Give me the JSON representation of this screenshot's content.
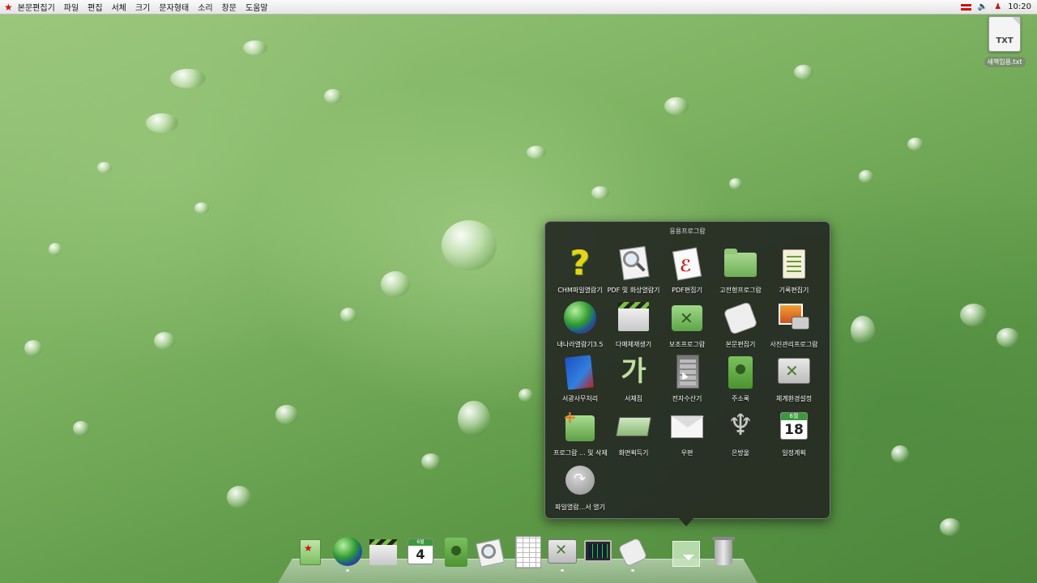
{
  "menubar": {
    "app_name": "본문편집기",
    "items": [
      "파일",
      "편집",
      "서체",
      "크기",
      "문자형태",
      "소리",
      "창문",
      "도움말"
    ],
    "clock": "10:20"
  },
  "desktop": {
    "file": {
      "ext": "TXT",
      "name": "새책임용.txt"
    }
  },
  "stack": {
    "title": "응용프로그람",
    "apps": [
      {
        "label": "CHM파일열람기",
        "icon": "chm-help-icon"
      },
      {
        "label": "PDF 및 화상열람기",
        "icon": "pdf-viewer-icon"
      },
      {
        "label": "PDF편집기",
        "icon": "pdf-editor-icon"
      },
      {
        "label": "고전형프로그람",
        "icon": "folder-icon"
      },
      {
        "label": "기록편집기",
        "icon": "notepad-icon"
      },
      {
        "label": "내나라열람기3.5",
        "icon": "globe-icon"
      },
      {
        "label": "다매체재생기",
        "icon": "clapperboard-icon"
      },
      {
        "label": "보조프로그람",
        "icon": "tools-folder-icon"
      },
      {
        "label": "본문편집기",
        "icon": "text-editor-icon"
      },
      {
        "label": "사진관리프로그람",
        "icon": "photo-camera-icon"
      },
      {
        "label": "서광사무처리",
        "icon": "office-suite-icon"
      },
      {
        "label": "서체집",
        "icon": "font-book-icon"
      },
      {
        "label": "전자수산기",
        "icon": "calculator-icon"
      },
      {
        "label": "주소록",
        "icon": "address-book-icon"
      },
      {
        "label": "체계환경설정",
        "icon": "system-settings-icon"
      },
      {
        "label": "프로그람 ... 및 삭제",
        "icon": "package-installer-icon"
      },
      {
        "label": "화면획득기",
        "icon": "screenshot-icon"
      },
      {
        "label": "우편",
        "icon": "mail-icon"
      },
      {
        "label": "은방울",
        "icon": "harp-icon"
      },
      {
        "label": "일정계획",
        "icon": "calendar-icon"
      },
      {
        "label": "파일열람...서 열기",
        "icon": "open-with-icon"
      }
    ],
    "calendar_month": "6월",
    "calendar_day": "18"
  },
  "dock": {
    "calendar_month": "6월",
    "calendar_day": "4"
  }
}
